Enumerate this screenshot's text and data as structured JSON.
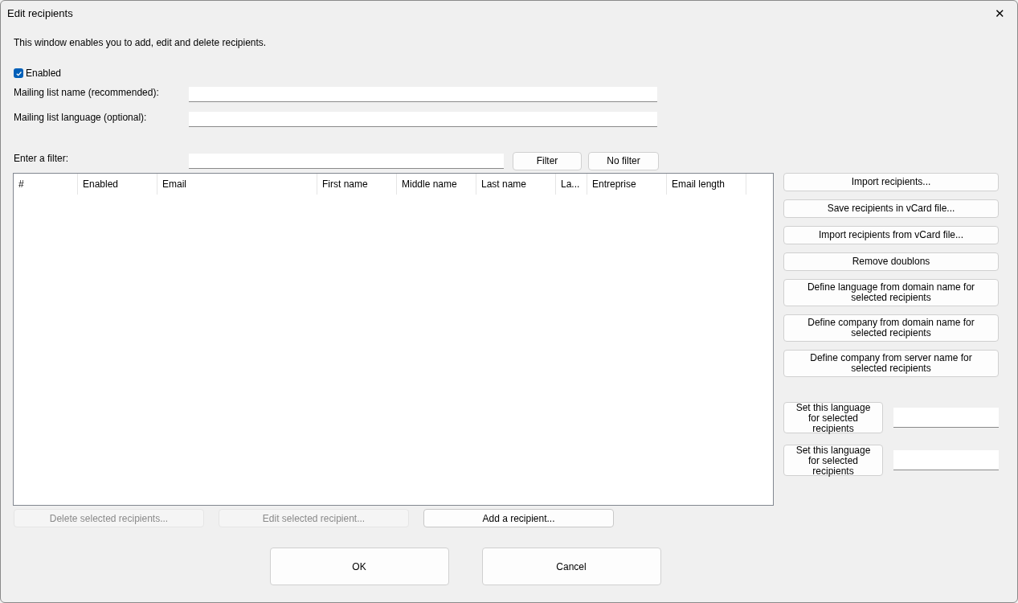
{
  "window": {
    "title": "Edit recipients",
    "close": "✕"
  },
  "description": "This window enables you to add, edit and delete recipients.",
  "enabled_checkbox": {
    "label": "Enabled",
    "checked": true
  },
  "fields": [
    {
      "label": "Mailing list name (recommended):"
    },
    {
      "label": "Mailing list language (optional):"
    }
  ],
  "filter": {
    "label": "Enter a filter:",
    "buttons": [
      "Filter",
      "No filter"
    ]
  },
  "table": {
    "columns": [
      "#",
      "Enabled",
      "Email",
      "First name",
      "Middle name",
      "Last name",
      "La...",
      "Entreprise",
      "Email length"
    ]
  },
  "side_buttons": [
    {
      "label": "Import recipients..."
    },
    {
      "label": "Save recipients in vCard file..."
    },
    {
      "label": "Import recipients from vCard file..."
    },
    {
      "label": "Remove doublons"
    },
    {
      "label": "Define language from domain name for selected recipients"
    },
    {
      "label": "Define company from domain name for selected recipients"
    },
    {
      "label": "Define company from server name for selected recipients"
    }
  ],
  "language_setters": [
    {
      "button": "Set this language for selected recipients"
    },
    {
      "button": "Set this language for selected recipients"
    }
  ],
  "table_buttons": [
    {
      "label": "Delete selected recipients...",
      "disabled": true
    },
    {
      "label": "Edit selected recipient...",
      "disabled": true
    },
    {
      "label": "Add a recipient...",
      "disabled": false
    }
  ],
  "dialog_buttons": [
    "OK",
    "Cancel"
  ]
}
